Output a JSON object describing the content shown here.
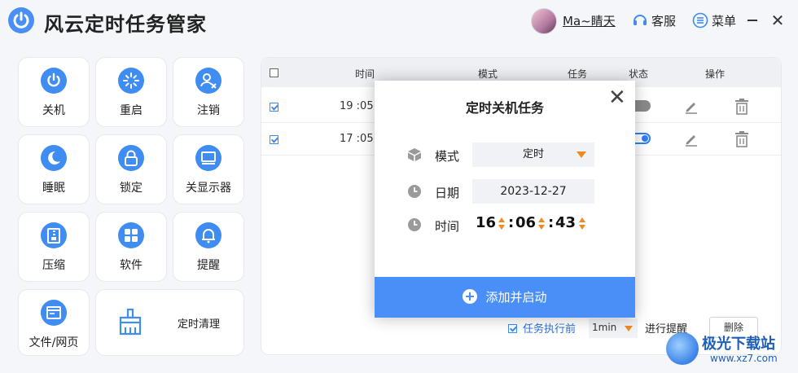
{
  "app": {
    "title": "风云定时任务管家"
  },
  "header": {
    "username": "Ma~睛天",
    "service": "客服",
    "menu": "菜单"
  },
  "tiles": [
    {
      "label": "关机",
      "icon": "power-icon"
    },
    {
      "label": "重启",
      "icon": "restart-icon"
    },
    {
      "label": "注销",
      "icon": "logout-user-icon"
    },
    {
      "label": "睡眠",
      "icon": "moon-icon"
    },
    {
      "label": "锁定",
      "icon": "lock-icon"
    },
    {
      "label": "关显示器",
      "icon": "monitor-icon"
    },
    {
      "label": "压缩",
      "icon": "zip-icon"
    },
    {
      "label": "软件",
      "icon": "apps-icon"
    },
    {
      "label": "提醒",
      "icon": "bell-icon"
    },
    {
      "label": "文件/网页",
      "icon": "browser-icon"
    },
    {
      "label": "定时清理",
      "icon": "broom-icon"
    }
  ],
  "table": {
    "headers": {
      "time": "时间",
      "mode": "模式",
      "task": "任务",
      "status": "状态",
      "action": "操作"
    },
    "rows": [
      {
        "time": "19 :05",
        "checked": true,
        "status": "off"
      },
      {
        "time": "17 :05",
        "checked": true,
        "status": "on"
      }
    ]
  },
  "footer": {
    "remind_before_label": "任务执行前",
    "interval": "1min",
    "remind_suffix": "进行提醒",
    "delete_label": "删除"
  },
  "dialog": {
    "title": "定时关机任务",
    "mode_label": "模式",
    "mode_value": "定时",
    "date_label": "日期",
    "date_value": "2023-12-27",
    "time_label": "时间",
    "hour": "16",
    "minute": "06",
    "second": "43",
    "confirm": "添加并启动"
  },
  "watermark": {
    "text": "极光下载站",
    "url": "www.xz7.com"
  },
  "colors": {
    "accent": "#4a8ff7",
    "arrow": "#f08a1e"
  }
}
